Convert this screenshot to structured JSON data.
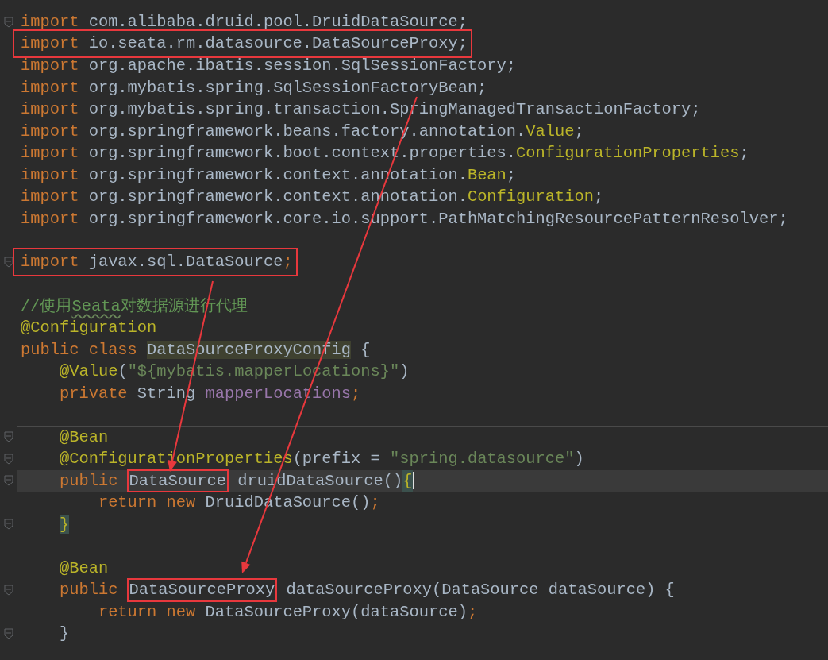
{
  "editor": {
    "lines": [
      {
        "fold": true,
        "boxed": false,
        "current": false,
        "separator_above": false,
        "tokens": [
          {
            "kind": "keyword",
            "text": "import"
          },
          {
            "kind": "plain",
            "text": " com.alibaba.druid.pool.DruidDataSource;"
          }
        ]
      },
      {
        "fold": false,
        "boxed": true,
        "current": false,
        "separator_above": false,
        "tokens": [
          {
            "kind": "keyword",
            "text": "import"
          },
          {
            "kind": "plain",
            "text": " io.seata.rm.datasource.DataSourceProxy;"
          }
        ]
      },
      {
        "fold": false,
        "boxed": false,
        "current": false,
        "separator_above": false,
        "tokens": [
          {
            "kind": "keyword",
            "text": "import"
          },
          {
            "kind": "plain",
            "text": " org.apache.ibatis.session.SqlSessionFactory;"
          }
        ]
      },
      {
        "fold": false,
        "boxed": false,
        "current": false,
        "separator_above": false,
        "tokens": [
          {
            "kind": "keyword",
            "text": "import"
          },
          {
            "kind": "plain",
            "text": " org.mybatis.spring.SqlSessionFactoryBean;"
          }
        ]
      },
      {
        "fold": false,
        "boxed": false,
        "current": false,
        "separator_above": false,
        "tokens": [
          {
            "kind": "keyword",
            "text": "import"
          },
          {
            "kind": "plain",
            "text": " org.mybatis.spring.transaction.SpringManagedTransactionFactory;"
          }
        ]
      },
      {
        "fold": false,
        "boxed": false,
        "current": false,
        "separator_above": false,
        "tokens": [
          {
            "kind": "keyword",
            "text": "import"
          },
          {
            "kind": "plain",
            "text": " org.springframework.beans.factory.annotation."
          },
          {
            "kind": "annotation",
            "text": "Value"
          },
          {
            "kind": "plain",
            "text": ";"
          }
        ]
      },
      {
        "fold": false,
        "boxed": false,
        "current": false,
        "separator_above": false,
        "tokens": [
          {
            "kind": "keyword",
            "text": "import"
          },
          {
            "kind": "plain",
            "text": " org.springframework.boot.context.properties."
          },
          {
            "kind": "annotation",
            "text": "ConfigurationProperties"
          },
          {
            "kind": "plain",
            "text": ";"
          }
        ]
      },
      {
        "fold": false,
        "boxed": false,
        "current": false,
        "separator_above": false,
        "tokens": [
          {
            "kind": "keyword",
            "text": "import"
          },
          {
            "kind": "plain",
            "text": " org.springframework.context.annotation."
          },
          {
            "kind": "annotation",
            "text": "Bean"
          },
          {
            "kind": "plain",
            "text": ";"
          }
        ]
      },
      {
        "fold": false,
        "boxed": false,
        "current": false,
        "separator_above": false,
        "tokens": [
          {
            "kind": "keyword",
            "text": "import"
          },
          {
            "kind": "plain",
            "text": " org.springframework.context.annotation."
          },
          {
            "kind": "annotation",
            "text": "Configuration"
          },
          {
            "kind": "plain",
            "text": ";"
          }
        ]
      },
      {
        "fold": false,
        "boxed": false,
        "current": false,
        "separator_above": false,
        "tokens": [
          {
            "kind": "keyword",
            "text": "import"
          },
          {
            "kind": "plain",
            "text": " org.springframework.core.io.support.PathMatchingResourcePatternResolver;"
          }
        ]
      },
      {
        "fold": false,
        "boxed": false,
        "current": false,
        "separator_above": false
      },
      {
        "fold": true,
        "boxed": true,
        "current": false,
        "separator_above": false,
        "tokens": [
          {
            "kind": "keyword",
            "text": "import"
          },
          {
            "kind": "plain",
            "text": " javax.sql.DataSource"
          },
          {
            "kind": "keyword",
            "text": ";"
          }
        ]
      },
      {
        "fold": false,
        "boxed": false,
        "current": false,
        "separator_above": false
      },
      {
        "fold": false,
        "boxed": false,
        "current": false,
        "separator_above": false,
        "tokens": [
          {
            "kind": "comment",
            "text": "//使用"
          },
          {
            "kind": "comment",
            "text": "Seata",
            "typo": true
          },
          {
            "kind": "comment",
            "text": "对数据源进行代理"
          }
        ]
      },
      {
        "fold": false,
        "boxed": false,
        "current": false,
        "separator_above": false,
        "tokens": [
          {
            "kind": "annotation",
            "text": "@Configuration"
          }
        ]
      },
      {
        "fold": false,
        "boxed": false,
        "current": false,
        "separator_above": false,
        "tokens": [
          {
            "kind": "keyword",
            "text": "public class "
          },
          {
            "kind": "plain",
            "text": "DataSourceProxyConfig",
            "highlighted": true
          },
          {
            "kind": "plain",
            "text": " {"
          }
        ]
      },
      {
        "fold": false,
        "boxed": false,
        "current": false,
        "separator_above": false,
        "tokens": [
          {
            "kind": "annotation",
            "text": "    @Value"
          },
          {
            "kind": "plain",
            "text": "("
          },
          {
            "kind": "string",
            "text": "\"${mybatis.mapperLocations}\""
          },
          {
            "kind": "plain",
            "text": ")"
          }
        ]
      },
      {
        "fold": false,
        "boxed": false,
        "current": false,
        "separator_above": false,
        "tokens": [
          {
            "kind": "keyword",
            "text": "    private "
          },
          {
            "kind": "plain",
            "text": "String "
          },
          {
            "kind": "field",
            "text": "mapperLocations"
          },
          {
            "kind": "keyword",
            "text": ";"
          }
        ]
      },
      {
        "fold": false,
        "boxed": false,
        "current": false,
        "separator_above": false
      },
      {
        "fold": true,
        "boxed": false,
        "current": false,
        "separator_above": true,
        "tokens": [
          {
            "kind": "annotation",
            "text": "    @Bean"
          }
        ]
      },
      {
        "fold": true,
        "boxed": false,
        "current": false,
        "separator_above": false,
        "tokens": [
          {
            "kind": "annotation",
            "text": "    @ConfigurationProperties"
          },
          {
            "kind": "plain",
            "text": "(prefix = "
          },
          {
            "kind": "string",
            "text": "\"spring.datasource\""
          },
          {
            "kind": "plain",
            "text": ")"
          }
        ]
      },
      {
        "fold": true,
        "boxed": false,
        "current": true,
        "separator_above": false,
        "tokens": [
          {
            "kind": "keyword",
            "text": "    public "
          },
          {
            "kind": "plain",
            "text": "DataSource",
            "boxed": true
          },
          {
            "kind": "plain",
            "text": " druidDataSource()"
          },
          {
            "kind": "annotation",
            "text": "{",
            "matched": true,
            "cursor": true
          }
        ]
      },
      {
        "fold": false,
        "boxed": false,
        "current": false,
        "separator_above": false,
        "tokens": [
          {
            "kind": "keyword",
            "text": "        return new "
          },
          {
            "kind": "plain",
            "text": "DruidDataSource()"
          },
          {
            "kind": "keyword",
            "text": ";"
          }
        ]
      },
      {
        "fold": true,
        "boxed": false,
        "current": false,
        "separator_above": false,
        "tokens": [
          {
            "kind": "annotation",
            "text": "    }",
            "matched": true
          }
        ]
      },
      {
        "fold": false,
        "boxed": false,
        "current": false,
        "separator_above": false
      },
      {
        "fold": false,
        "boxed": false,
        "current": false,
        "separator_above": true,
        "tokens": [
          {
            "kind": "annotation",
            "text": "    @Bean"
          }
        ]
      },
      {
        "fold": true,
        "boxed": false,
        "current": false,
        "separator_above": false,
        "tokens": [
          {
            "kind": "keyword",
            "text": "    public "
          },
          {
            "kind": "plain",
            "text": "DataSourceProxy",
            "boxed": true
          },
          {
            "kind": "plain",
            "text": " dataSourceProxy(DataSource dataSource) {"
          }
        ]
      },
      {
        "fold": false,
        "boxed": false,
        "current": false,
        "separator_above": false,
        "tokens": [
          {
            "kind": "keyword",
            "text": "        return new "
          },
          {
            "kind": "plain",
            "text": "DataSourceProxy(dataSource)"
          },
          {
            "kind": "keyword",
            "text": ";"
          }
        ]
      },
      {
        "fold": true,
        "boxed": false,
        "current": false,
        "separator_above": false,
        "tokens": [
          {
            "kind": "plain",
            "text": "    }"
          }
        ]
      }
    ]
  }
}
